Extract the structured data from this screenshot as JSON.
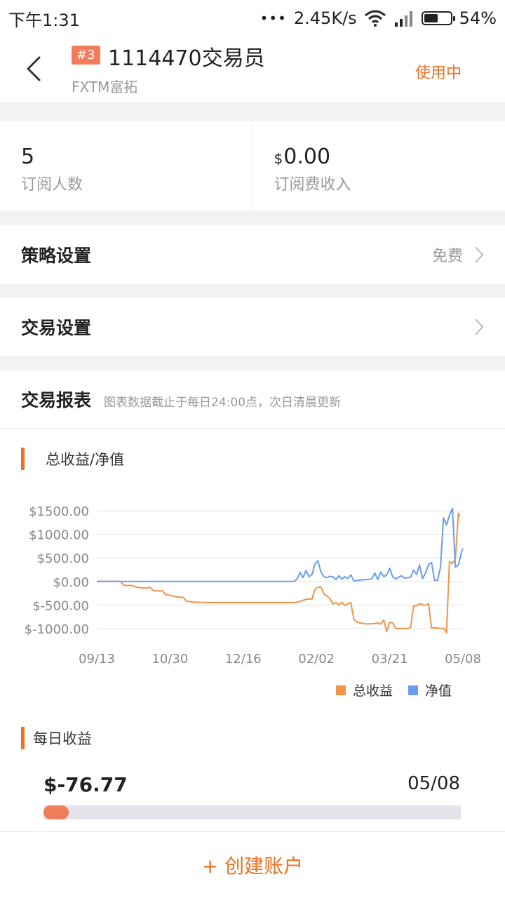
{
  "status_bar": {
    "time": "下午1:31",
    "network_speed": "2.45K/s",
    "battery_level": "54%",
    "battery_fraction": 0.54
  },
  "header": {
    "rank_badge": "#3",
    "title": "1114470交易员",
    "broker": "FXTM富拓",
    "status": "使用中"
  },
  "stats": [
    {
      "value": "5",
      "label": "订阅人数"
    },
    {
      "currency": "$",
      "value": "0.00",
      "label": "订阅费收入"
    }
  ],
  "settings": {
    "strategy": {
      "label": "策略设置",
      "value": "免费"
    },
    "trade": {
      "label": "交易设置"
    }
  },
  "report": {
    "title": "交易报表",
    "note": "图表数据截止于每日24:00点，次日清晨更新",
    "chart_section_title": "总收益/净值",
    "daily_section_title": "每日收益",
    "daily_value": "$-76.77",
    "daily_date": "05/08",
    "daily_fill_fraction": 0.06
  },
  "chart_data": {
    "type": "line",
    "ylim": [
      -1000,
      1500
    ],
    "yticks": [
      1500,
      1000,
      500,
      0,
      -500,
      -1000
    ],
    "ytick_labels": [
      "$1500.00",
      "$1000.00",
      "$500.00",
      "$0.00",
      "$-500.00",
      "$-1000.00"
    ],
    "xtick_labels": [
      "09/13",
      "10/30",
      "12/16",
      "02/02",
      "03/21",
      "05/08"
    ],
    "grid": true,
    "legend_position": "bottom-right",
    "series": [
      {
        "name": "总收益",
        "color": "#f4934a",
        "points": [
          [
            0,
            0
          ],
          [
            5,
            0
          ],
          [
            8,
            0
          ],
          [
            9,
            -80
          ],
          [
            12,
            -90
          ],
          [
            13,
            -120
          ],
          [
            16,
            -140
          ],
          [
            18,
            -130
          ],
          [
            19,
            -200
          ],
          [
            22,
            -200
          ],
          [
            23,
            -280
          ],
          [
            25,
            -300
          ],
          [
            27,
            -330
          ],
          [
            29,
            -340
          ],
          [
            30,
            -420
          ],
          [
            33,
            -440
          ],
          [
            38,
            -450
          ],
          [
            45,
            -450
          ],
          [
            52,
            -450
          ],
          [
            60,
            -450
          ],
          [
            66,
            -450
          ],
          [
            67,
            -440
          ],
          [
            69,
            -400
          ],
          [
            70,
            -380
          ],
          [
            72,
            -370
          ],
          [
            73,
            -170
          ],
          [
            74,
            -120
          ],
          [
            75,
            -115
          ],
          [
            76,
            -260
          ],
          [
            78,
            -360
          ],
          [
            79,
            -480
          ],
          [
            80,
            -450
          ],
          [
            81,
            -500
          ],
          [
            82,
            -440
          ],
          [
            83,
            -510
          ],
          [
            84,
            -470
          ],
          [
            85,
            -450
          ],
          [
            86,
            -800
          ],
          [
            87,
            -860
          ],
          [
            88,
            -880
          ],
          [
            90,
            -900
          ],
          [
            92,
            -900
          ],
          [
            94,
            -880
          ],
          [
            95,
            -905
          ],
          [
            96,
            -820
          ],
          [
            97,
            -1060
          ],
          [
            98,
            -870
          ],
          [
            99,
            -880
          ],
          [
            100,
            -1000
          ],
          [
            102,
            -1000
          ],
          [
            104,
            -1000
          ],
          [
            105,
            -980
          ],
          [
            106,
            -520
          ],
          [
            107,
            -520
          ],
          [
            108,
            -470
          ],
          [
            110,
            -510
          ],
          [
            111,
            -470
          ],
          [
            112,
            -990
          ],
          [
            113,
            -980
          ],
          [
            114,
            -990
          ],
          [
            115,
            -1000
          ],
          [
            116,
            -990
          ],
          [
            117,
            -1090
          ],
          [
            118,
            420
          ],
          [
            119,
            380
          ],
          [
            120,
            480
          ],
          [
            121,
            1450
          ],
          [
            121.5,
            1380
          ]
        ]
      },
      {
        "name": "净值",
        "color": "#6a9cf0",
        "points": [
          [
            0,
            0
          ],
          [
            10,
            0
          ],
          [
            20,
            0
          ],
          [
            30,
            0
          ],
          [
            40,
            0
          ],
          [
            50,
            0
          ],
          [
            60,
            0
          ],
          [
            66,
            0
          ],
          [
            67,
            50
          ],
          [
            68,
            190
          ],
          [
            69,
            80
          ],
          [
            70,
            230
          ],
          [
            71,
            100
          ],
          [
            72,
            150
          ],
          [
            73,
            370
          ],
          [
            74,
            440
          ],
          [
            75,
            200
          ],
          [
            76,
            100
          ],
          [
            77,
            80
          ],
          [
            78,
            110
          ],
          [
            79,
            100
          ],
          [
            80,
            40
          ],
          [
            81,
            120
          ],
          [
            82,
            50
          ],
          [
            83,
            100
          ],
          [
            84,
            60
          ],
          [
            85,
            140
          ],
          [
            86,
            10
          ],
          [
            87,
            20
          ],
          [
            88,
            30
          ],
          [
            90,
            40
          ],
          [
            92,
            50
          ],
          [
            93,
            180
          ],
          [
            94,
            40
          ],
          [
            95,
            200
          ],
          [
            96,
            100
          ],
          [
            97,
            140
          ],
          [
            98,
            280
          ],
          [
            99,
            100
          ],
          [
            100,
            50
          ],
          [
            101,
            90
          ],
          [
            102,
            120
          ],
          [
            103,
            70
          ],
          [
            104,
            80
          ],
          [
            105,
            90
          ],
          [
            106,
            240
          ],
          [
            107,
            150
          ],
          [
            108,
            350
          ],
          [
            109,
            60
          ],
          [
            110,
            180
          ],
          [
            111,
            360
          ],
          [
            112,
            400
          ],
          [
            113,
            30
          ],
          [
            114,
            20
          ],
          [
            115,
            300
          ],
          [
            116,
            1350
          ],
          [
            117,
            1200
          ],
          [
            118,
            1400
          ],
          [
            119,
            1550
          ],
          [
            120,
            300
          ],
          [
            121,
            350
          ],
          [
            122,
            620
          ],
          [
            122.5,
            700
          ]
        ]
      }
    ]
  },
  "bottom_button": "+ 创建账户"
}
